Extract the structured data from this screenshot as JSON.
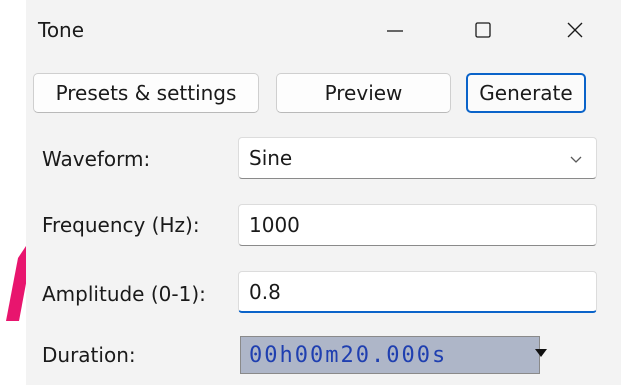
{
  "window": {
    "title": "Tone"
  },
  "toolbar": {
    "presets_label": "Presets & settings",
    "preview_label": "Preview",
    "generate_label": "Generate"
  },
  "form": {
    "waveform_label": "Waveform:",
    "waveform_value": "Sine",
    "frequency_label": "Frequency (Hz):",
    "frequency_value": "1000",
    "amplitude_label": "Amplitude (0-1):",
    "amplitude_value": "0.8",
    "duration_label": "Duration:",
    "duration": {
      "hours": "00",
      "h": "h",
      "minutes": "00",
      "m": "m",
      "seconds": "20",
      "dot": ".",
      "millis": "000",
      "s": "s"
    }
  },
  "colors": {
    "accent": "#0a63c9",
    "annotation": "#e8156e",
    "duration_bg": "#aeb6c8",
    "duration_text": "#1f3fb0"
  },
  "icons": {
    "minimize": "minimize-icon",
    "maximize": "maximize-icon",
    "close": "close-icon",
    "dropdown": "chevron-down-icon"
  }
}
